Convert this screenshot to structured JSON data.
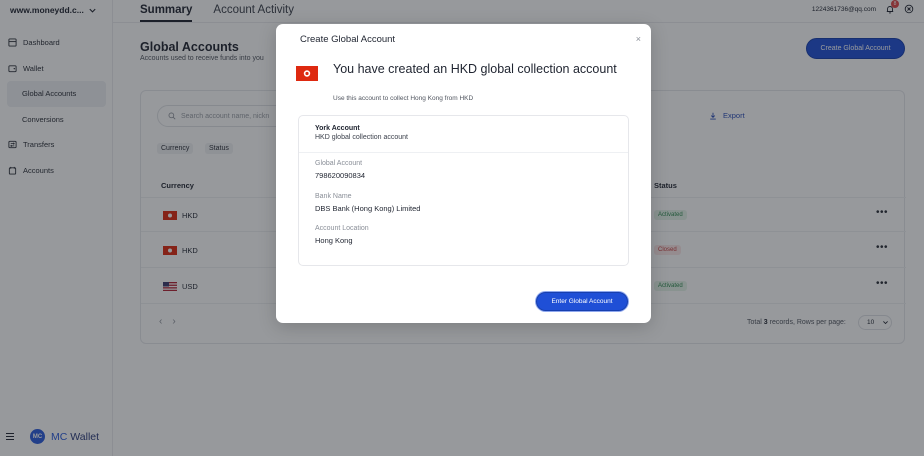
{
  "sidebar": {
    "domain": "www.moneydd.c...",
    "items": [
      {
        "label": "Dashboard",
        "icon": "dashboard-icon"
      },
      {
        "label": "Wallet",
        "icon": "wallet-icon"
      },
      {
        "label": "Global Accounts",
        "icon": ""
      },
      {
        "label": "Conversions",
        "icon": ""
      },
      {
        "label": "Transfers",
        "icon": "transfers-icon"
      },
      {
        "label": "Accounts",
        "icon": "accounts-icon"
      }
    ],
    "brand": {
      "mark": "MC",
      "name_part1": "MC",
      "name_part2": "Wallet"
    }
  },
  "topbar": {
    "tabs": [
      "Summary",
      "Account Activity"
    ],
    "user_email": "1224361736@qq.com",
    "notification_count": "8"
  },
  "main": {
    "title": "Global Accounts",
    "subtitle": "Accounts used to receive funds into you",
    "create_button": "Create Global Account",
    "search_placeholder": "Search account name, nickn",
    "export_label": "Export",
    "filters": [
      "Currency",
      "Status"
    ],
    "columns": {
      "currency": "Currency",
      "status": "Status"
    },
    "rows": [
      {
        "currency": "HKD",
        "flag": "hk",
        "status": "Activated",
        "status_color": "green"
      },
      {
        "currency": "HKD",
        "flag": "hk",
        "status": "Closed",
        "status_color": "red"
      },
      {
        "currency": "USD",
        "flag": "us",
        "status": "Activated",
        "status_color": "green"
      }
    ],
    "pagination": {
      "prev": "‹",
      "next": "›",
      "total_prefix": "Total",
      "total_count": "3",
      "total_suffix": "records, Rows per page:",
      "rows_per_page": "10"
    }
  },
  "modal": {
    "title": "Create Global Account",
    "close": "×",
    "headline": "You have created an HKD global collection account",
    "subtext": "Use this account to collect Hong Kong from HKD",
    "account_name": "York Account",
    "account_desc": "HKD global collection account",
    "fields": [
      {
        "label": "Global Account",
        "value": "798620090834"
      },
      {
        "label": "Bank Name",
        "value": "DBS Bank (Hong Kong) Limited"
      },
      {
        "label": "Account Location",
        "value": "Hong Kong"
      }
    ],
    "enter_button": "Enter Global Account"
  },
  "colors": {
    "accent": "#1f4fd6",
    "hk_flag": "#de2910",
    "status_green": "#2d8a4e",
    "status_red": "#c84040"
  }
}
